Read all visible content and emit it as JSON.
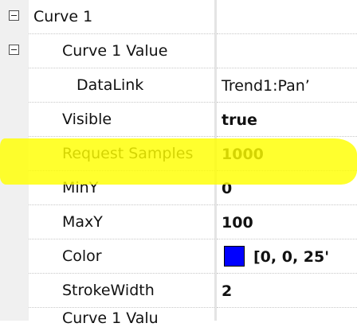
{
  "grid": {
    "rows": [
      {
        "label": "Curve 1",
        "value": "",
        "expander": "collapse"
      },
      {
        "label": "Curve 1 Value",
        "value": "",
        "expander": "collapse"
      },
      {
        "label": "DataLink",
        "value": "Trend1:Pan’",
        "expander": ""
      },
      {
        "label": "Visible",
        "value": "true",
        "expander": ""
      },
      {
        "label": "Request Samples",
        "value": "1000",
        "expander": "",
        "highlighted": true
      },
      {
        "label": "MinY",
        "value": "0",
        "expander": ""
      },
      {
        "label": "MaxY",
        "value": "100",
        "expander": ""
      },
      {
        "label": "Color",
        "value": "[0, 0, 25'",
        "expander": "",
        "swatch_color": "#0000ff"
      },
      {
        "label": "StrokeWidth",
        "value": "2",
        "expander": ""
      },
      {
        "label": "Curve 1 Valu",
        "value": "",
        "expander": "",
        "partial": true
      }
    ],
    "highlight_color": "#ffff00"
  }
}
